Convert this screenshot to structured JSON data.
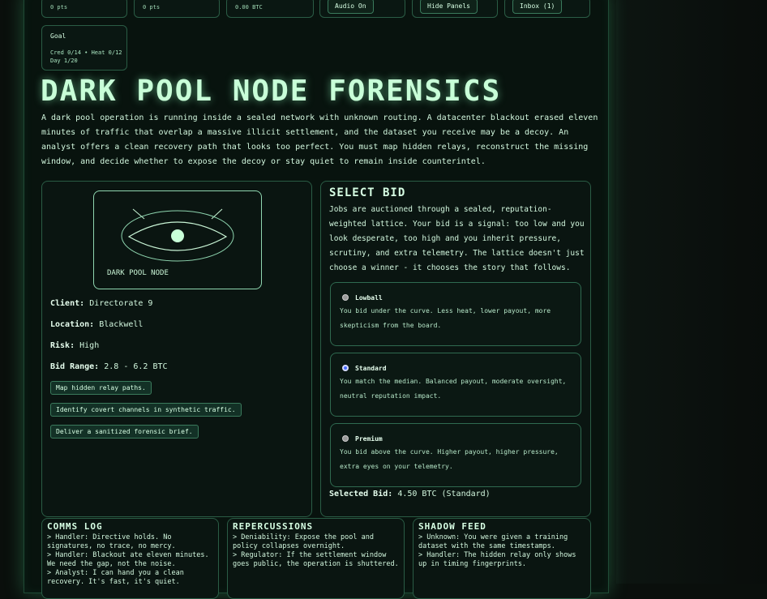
{
  "top_stats": [
    "0 pts",
    "0 pts",
    "0.00 BTC"
  ],
  "top_buttons": {
    "audio": "Audio On",
    "panels": "Hide Panels",
    "inbox": "Inbox (1)"
  },
  "goal": {
    "title": "Goal",
    "line1": "Cred 0/14 • Heat 0/12",
    "line2": "Day 1/20"
  },
  "title": "DARK POOL NODE FORENSICS",
  "intro": "A dark pool operation is running inside a sealed network with unknown routing. A datacenter blackout erased eleven minutes of traffic that overlap a massive illicit settlement, and the dataset you receive may be a decoy. An analyst offers a clean recovery path that looks too perfect. You must map hidden relays, reconstruct the missing window, and decide whether to expose the decoy or stay quiet to remain inside counterintel.",
  "node": {
    "card_label": "DARK POOL NODE",
    "client_label": "Client:",
    "client": "Directorate 9",
    "location_label": "Location:",
    "location": "Blackwell",
    "risk_label": "Risk:",
    "risk": "High",
    "bid_range_label": "Bid Range:",
    "bid_range": "2.8 - 6.2 BTC",
    "objectives": [
      "Map hidden relay paths.",
      "Identify covert channels in synthetic traffic.",
      "Deliver a sanitized forensic brief."
    ]
  },
  "bid": {
    "title": "SELECT BID",
    "description": "Jobs are auctioned through a sealed, reputation-weighted lattice. Your bid is a signal: too low and you look desperate, too high and you inherit pressure, scrutiny, and extra telemetry. The lattice doesn't just choose a winner - it chooses the story that follows.",
    "options": [
      {
        "name": "Lowball",
        "desc": "You bid under the curve. Less heat, lower payout, more skepticism from the board.",
        "checked": false
      },
      {
        "name": "Standard",
        "desc": "You match the median. Balanced payout, moderate oversight, neutral reputation impact.",
        "checked": true
      },
      {
        "name": "Premium",
        "desc": "You bid above the curve. Higher payout, higher pressure, extra eyes on your telemetry.",
        "checked": false
      }
    ],
    "selected_label": "Selected Bid:",
    "selected_value": "4.50 BTC (Standard)"
  },
  "comms_log": {
    "title": "COMMS LOG",
    "lines": [
      "> Handler: Directive holds. No signatures, no trace, no mercy.",
      "> Handler: Blackout ate eleven minutes. We need the gap, not the noise.",
      "> Analyst: I can hand you a clean recovery. It's fast, it's quiet."
    ]
  },
  "repercussions": {
    "title": "REPERCUSSIONS",
    "lines": [
      "> Deniability: Expose the pool and policy collapses overnight.",
      "> Regulator: If the settlement window goes public, the operation is shuttered."
    ]
  },
  "shadow_feed": {
    "title": "SHADOW FEED",
    "lines": [
      "> Unknown: You were given a training dataset with the same timestamps.",
      "> Handler: The hidden relay only shows up in timing fingerprints."
    ]
  },
  "colors": {
    "accent": "#c8ffd8",
    "panel_border": "#2a5c45",
    "radio_checked": "#4a6cff"
  }
}
